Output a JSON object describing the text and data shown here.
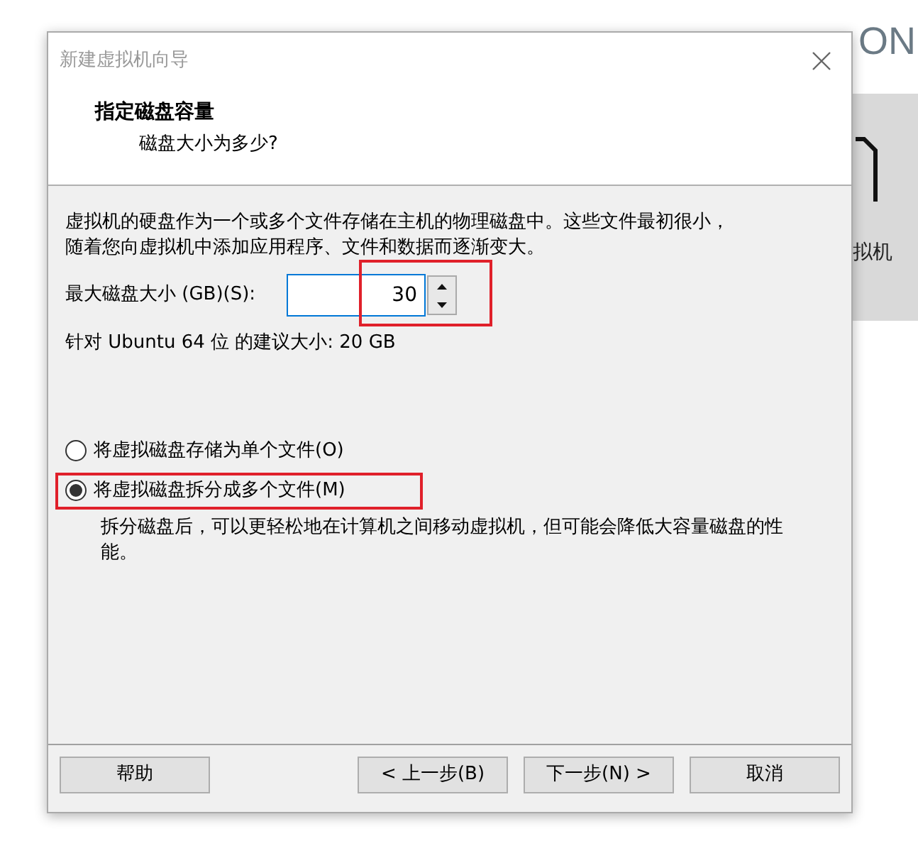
{
  "background": {
    "brand": "ON",
    "panel_label": "拟机"
  },
  "window": {
    "title": "新建虚拟机向导"
  },
  "header": {
    "title": "指定磁盘容量",
    "subtitle": "磁盘大小为多少?"
  },
  "body": {
    "description": [
      "虚拟机的硬盘作为一个或多个文件存储在主机的物理磁盘中。这些文件最初很小，",
      "随着您向虚拟机中添加应用程序、文件和数据而逐渐变大。"
    ],
    "size_field": {
      "label": "最大磁盘大小 (GB)(S):",
      "value": "30",
      "highlighted": true
    },
    "recommendation": "针对 Ubuntu 64 位 的建议大小: 20 GB",
    "options": [
      {
        "label": "将虚拟磁盘存储为单个文件(O)",
        "selected": false,
        "highlighted": false
      },
      {
        "label": "将虚拟磁盘拆分成多个文件(M)",
        "selected": true,
        "highlighted": true
      }
    ],
    "note": "拆分磁盘后，可以更轻松地在计算机之间移动虚拟机，但可能会降低大容量磁盘的性能。"
  },
  "buttons": [
    {
      "label": "帮助",
      "kind": "left"
    },
    {
      "label": "< 上一步(B)",
      "kind": "right"
    },
    {
      "label": "下一步(N) >",
      "kind": "right"
    },
    {
      "label": "取消",
      "kind": "right"
    }
  ]
}
